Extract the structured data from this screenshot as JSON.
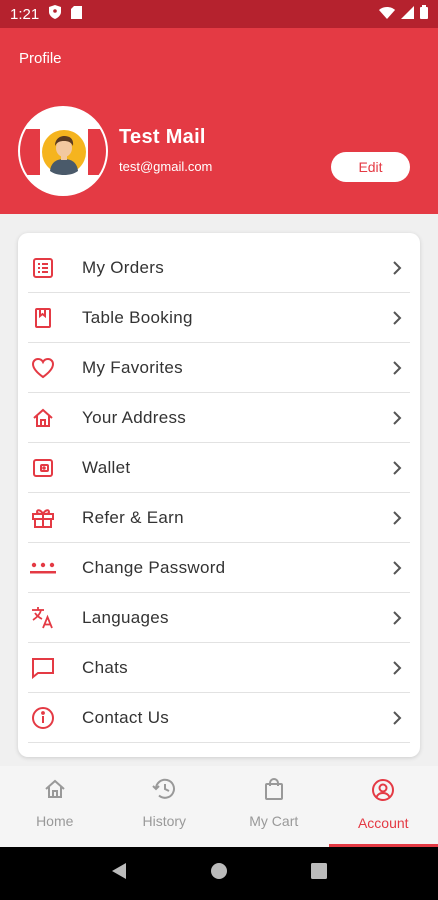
{
  "status_bar": {
    "time": "1:21"
  },
  "header": {
    "title": "Profile"
  },
  "user": {
    "name": "Test  Mail",
    "email": "test@gmail.com",
    "edit_label": "Edit"
  },
  "menu": {
    "items": [
      {
        "label": "My Orders",
        "icon": "orders-list-icon"
      },
      {
        "label": "Table Booking",
        "icon": "bookmark-icon"
      },
      {
        "label": "My Favorites",
        "icon": "heart-icon"
      },
      {
        "label": "Your Address",
        "icon": "home-icon"
      },
      {
        "label": "Wallet",
        "icon": "wallet-icon"
      },
      {
        "label": "Refer & Earn",
        "icon": "gift-icon"
      },
      {
        "label": "Change Password",
        "icon": "password-dots-icon"
      },
      {
        "label": "Languages",
        "icon": "translate-icon"
      },
      {
        "label": "Chats",
        "icon": "chat-icon"
      },
      {
        "label": "Contact Us",
        "icon": "info-icon"
      }
    ]
  },
  "bottom_nav": {
    "items": [
      {
        "label": "Home",
        "icon": "home-icon"
      },
      {
        "label": "History",
        "icon": "history-icon"
      },
      {
        "label": "My Cart",
        "icon": "shopping-bag-icon"
      },
      {
        "label": "Account",
        "icon": "account-icon",
        "active": true
      }
    ]
  },
  "colors": {
    "accent": "#e43a44",
    "status_bar": "#b5222e",
    "muted": "#999999"
  }
}
